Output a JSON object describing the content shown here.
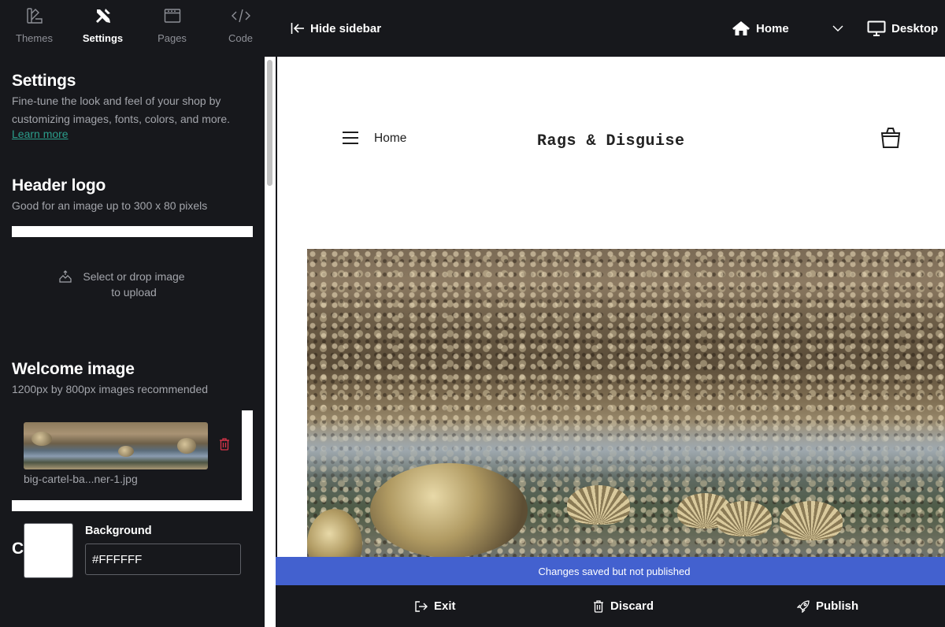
{
  "sidebar": {
    "tabs": [
      {
        "label": "Themes",
        "icon": "themes-icon",
        "active": false
      },
      {
        "label": "Settings",
        "icon": "settings-tools-icon",
        "active": true
      },
      {
        "label": "Pages",
        "icon": "pages-icon",
        "active": false
      },
      {
        "label": "Code",
        "icon": "code-icon",
        "active": false
      }
    ],
    "settings": {
      "title": "Settings",
      "description": "Fine-tune the look and feel of your shop by customizing images, fonts, colors, and more.",
      "learn_more": "Learn more"
    },
    "header_logo": {
      "title": "Header logo",
      "description": "Good for an image up to 300 x 80 pixels",
      "drop_text": "Select or drop image to upload"
    },
    "welcome_image": {
      "title": "Welcome image",
      "description": "1200px by 800px images recommended",
      "file_name": "big-cartel-ba...ner-1.jpg"
    },
    "colors": {
      "title": "Colors",
      "background_label": "Background",
      "background_value": "#FFFFFF"
    }
  },
  "topbar": {
    "hide_sidebar": "Hide sidebar",
    "page_select": "Home",
    "device": "Desktop"
  },
  "preview": {
    "nav_home": "Home",
    "store_name": "Rags & Disguise"
  },
  "status": {
    "message": "Changes saved but not published",
    "color": "#4361cf"
  },
  "bottombar": {
    "exit": "Exit",
    "discard": "Discard",
    "publish": "Publish"
  },
  "theme": {
    "background": "#17181c",
    "accent_link": "#2b9e8b",
    "danger": "#d8344a"
  }
}
